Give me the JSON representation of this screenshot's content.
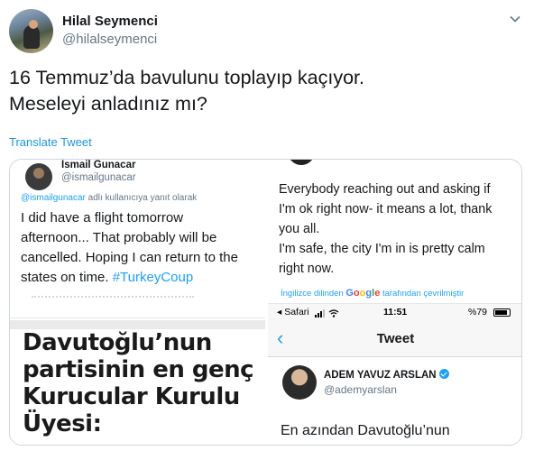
{
  "author": {
    "display_name": "Hilal Seymenci",
    "handle": "@hilalseymenci"
  },
  "tweet": {
    "line1": "16 Temmuz’da bavulunu toplayıp kaçıyor.",
    "line2": "Meseleyi anladınız mı?",
    "translate_label": "Translate Tweet"
  },
  "panel_left_top": {
    "name": "Ismail Gunacar",
    "handle": "@ismailgunacar",
    "reply_handle": "@ismailgunacar",
    "reply_suffix": " adlı kullanıcıya yanıt olarak",
    "text_line1": "I did have a flight tomorrow",
    "text_line2": "afternoon... That probably will be",
    "text_line3": "cancelled. Hoping I can return to the",
    "text_line4_prefix": "states on time. ",
    "hashtag": "#TurkeyCoup"
  },
  "panel_right": {
    "text_line1": "Everybody reaching out and asking if",
    "text_line2": "I'm ok right now- it means a lot, thank",
    "text_line3": "you all.",
    "text_line4": "I'm safe, the city I'm in is pretty calm",
    "text_line5": "right now.",
    "translate_prefix": "İngilizce dilinden ",
    "translate_suffix": " tarafından çevrilmiştir",
    "status_carrier": "◂ Safari",
    "status_time": "11:51",
    "status_battery": "%79",
    "nav_back": "‹",
    "nav_title": "Tweet",
    "name": "ADEM YAVUZ ARSLAN",
    "handle": "@ademyarslan",
    "text": "En azından Davutoğlu’nun"
  },
  "panel_left_bottom": {
    "headline_line1": "Davutoğlu’nun",
    "headline_line2": "partisinin en genç",
    "headline_line3": "Kurucular Kurulu",
    "headline_line4": "Üyesi:"
  },
  "colors": {
    "link": "#1b95e0",
    "hashtag": "#1da1f2",
    "muted": "#657786"
  }
}
